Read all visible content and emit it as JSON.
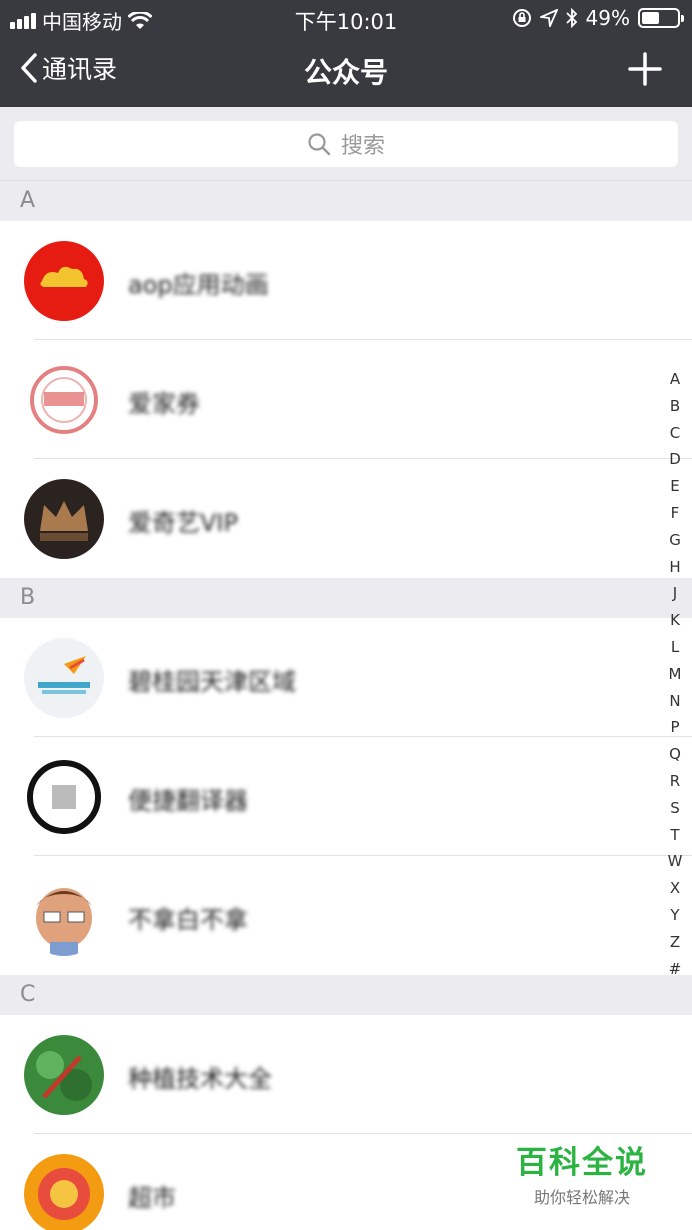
{
  "status_bar": {
    "carrier": "中国移动",
    "time": "下午10:01",
    "battery_percent": "49%",
    "battery_level": 0.49
  },
  "nav": {
    "back_label": "通讯录",
    "title": "公众号",
    "add_icon": "plus-icon"
  },
  "search": {
    "placeholder": "搜索"
  },
  "sections": [
    {
      "letter": "A",
      "items": [
        {
          "name": "aop应用动画",
          "avatar_icon": "red-cloud-logo"
        },
        {
          "name": "爱家券",
          "avatar_icon": "stamp-logo"
        },
        {
          "name": "爱奇艺VIP",
          "avatar_icon": "crown-logo"
        }
      ]
    },
    {
      "letter": "B",
      "items": [
        {
          "name": "碧桂园天津区域",
          "avatar_icon": "landscape-logo"
        },
        {
          "name": "便捷翻译器",
          "avatar_icon": "circle-logo"
        },
        {
          "name": "不拿白不拿",
          "avatar_icon": "cartoon-face-logo"
        }
      ]
    },
    {
      "letter": "C",
      "items": [
        {
          "name": "种植技术大全",
          "avatar_icon": "plant-logo"
        },
        {
          "name": "超市",
          "avatar_icon": "orange-logo"
        }
      ]
    }
  ],
  "index_letters": [
    "A",
    "B",
    "C",
    "D",
    "E",
    "F",
    "G",
    "H",
    "J",
    "K",
    "L",
    "M",
    "N",
    "P",
    "Q",
    "R",
    "S",
    "T",
    "W",
    "X",
    "Y",
    "Z",
    "#"
  ],
  "watermark": {
    "title": "百科全说",
    "subtitle": "助你轻松解决"
  },
  "colors": {
    "nav_bg": "#393a3f",
    "section_bg": "#ebebf0",
    "watermark_green": "#2bb441"
  }
}
